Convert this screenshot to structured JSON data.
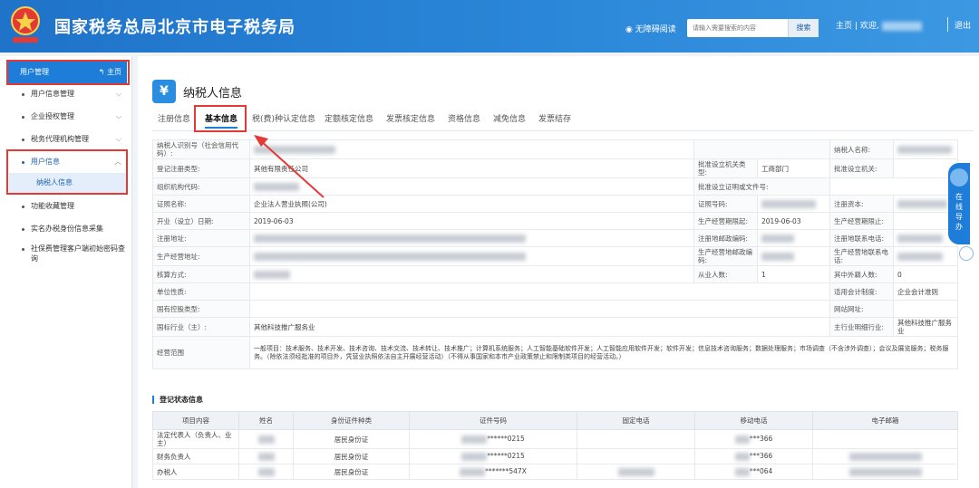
{
  "header": {
    "title": "国家税务总局北京市电子税务局",
    "accessibility": "无障碍阅读",
    "search_placeholder": "请输入需要搜索的内容",
    "search_button": "搜索",
    "home": "主页",
    "welcome": "欢迎,",
    "logout": "退出"
  },
  "sidebar": {
    "head": "用户管理",
    "home": "主页",
    "items": [
      {
        "label": "用户信息管理"
      },
      {
        "label": "企业授权管理"
      },
      {
        "label": "税务代理机构管理"
      },
      {
        "label": "用户信息"
      },
      {
        "label": "功能收藏管理"
      },
      {
        "label": "实名办税身份信息采集"
      },
      {
        "label": "社保费管理客户端初始密码查询"
      }
    ],
    "sub_item": "纳税人信息"
  },
  "main": {
    "title": "纳税人信息",
    "tabs": [
      "注册信息",
      "基本信息",
      "税(费)种认定信息",
      "定额核定信息",
      "发票核定信息",
      "资格信息",
      "减免信息",
      "发票结存"
    ],
    "info": {
      "taxpayer_id_label": "纳税人识别号（社会信用代码）:",
      "taxpayer_name_label": "纳税人名称:",
      "reg_type_label": "登记注册类型:",
      "reg_type_value": "其他有限责任公司",
      "approve_org_label": "批准设立机关类型:",
      "dept_label": "工商部门",
      "approve_agency_label": "批准设立机关:",
      "org_code_label": "组织机构代码:",
      "approve_doc_label": "批准设立证明或文件号:",
      "cert_name_label": "证照名称:",
      "cert_name_value": "企业法人营业执照(公司)",
      "cert_no_label": "证照号码:",
      "capital_label": "注册资本:",
      "open_date_label": "开业（设立）日期:",
      "open_date_value": "2019-06-03",
      "op_start_label": "生产经营期限起:",
      "op_start_value": "2019-06-03",
      "op_end_label": "生产经营期限止:",
      "reg_addr_label": "注册地址:",
      "reg_zip_label": "注册地邮政编码:",
      "reg_phone_label": "注册地联系电话:",
      "op_addr_label": "生产经营地址:",
      "op_zip_label": "生产经营地邮政编码:",
      "op_phone_label": "生产经营地联系电话:",
      "accounting_label": "核算方式:",
      "employees_label": "从业人数:",
      "employees_value": "1",
      "foreign_label": "其中外籍人数:",
      "foreign_value": "0",
      "unit_nature_label": "单位性质:",
      "acct_system_label": "适用会计制度:",
      "acct_system_value": "企业会计准则",
      "state_label": "国有控股类型:",
      "website_label": "网站网址:",
      "industry_label": "国标行业（主）:",
      "industry_value": "其他科技推广服务业",
      "main_industry_label": "主行业明细行业:",
      "main_industry_value": "其他科技推广服务业",
      "scope_label": "经营范围",
      "scope_value": "一般项目：技术服务、技术开发、技术咨询、技术交流、技术转让、技术推广；计算机系统服务；人工智能基础软件开发；人工智能应用软件开发；软件开发；信息技术咨询服务；数据处理服务；市场调查（不含涉外调查）；会议及展览服务；税务服务。（除依法须经批准的项目外，凭营业执照依法自主开展经营活动）（不得从事国家和本市产业政策禁止和限制类项目的经营活动。）"
    },
    "section_title": "登记状态信息",
    "reg_columns": [
      "项目内容",
      "姓名",
      "身份证件种类",
      "证件号码",
      "固定电话",
      "移动电话",
      "电子邮箱"
    ],
    "reg_rows": [
      {
        "item": "法定代表人（负责人、业主）",
        "id_type": "居民身份证",
        "id_no": "******0215",
        "mobile": "***366"
      },
      {
        "item": "财务负责人",
        "id_type": "居民身份证",
        "id_no": "******0215",
        "mobile": "***366"
      },
      {
        "item": "办税人",
        "id_type": "居民身份证",
        "id_no": "*******547X",
        "mobile": "***064"
      }
    ]
  },
  "float": {
    "help": "在线导办"
  }
}
